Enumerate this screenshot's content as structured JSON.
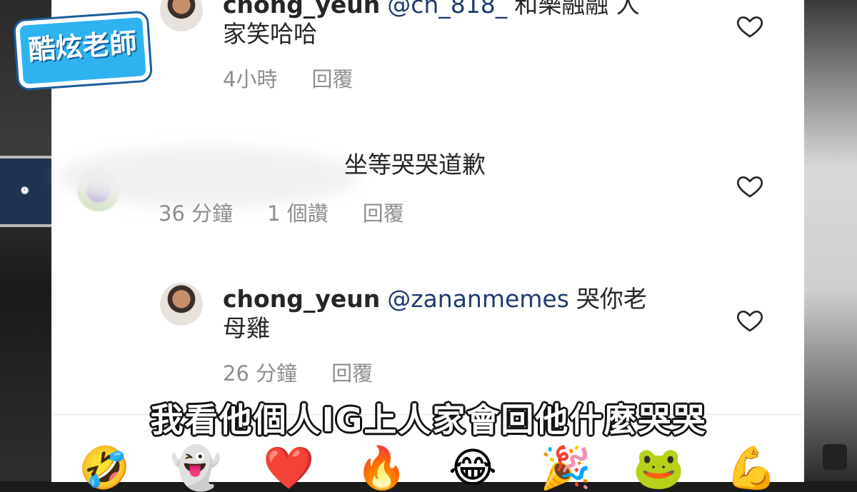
{
  "channel_logo": "酷炫老師",
  "comments": [
    {
      "username": "chong_yeun",
      "mention": "@ch_818_",
      "text_line1": "和樂融融 人",
      "text_line2": "家笑哈哈",
      "time": "4小時",
      "reply": "回覆"
    },
    {
      "username": "",
      "text": "坐等哭哭道歉",
      "time": "36 分鐘",
      "likes": "1 個讚",
      "reply": "回覆"
    },
    {
      "username": "chong_yeun",
      "mention": "@zananmemes",
      "text_line1": "哭你老",
      "text_line2": "母雞",
      "time": "26 分鐘",
      "reply": "回覆"
    }
  ],
  "subtitle": "我看他個人IG上人家會回他什麼哭哭",
  "emoji_bar": [
    "🤣",
    "👻",
    "❤️",
    "🔥",
    "😂",
    "🎉",
    "🐸",
    "💪"
  ],
  "colors": {
    "mention": "#1f3b6e",
    "meta": "#8e8e8e",
    "logo_bg": "#2fb3f0"
  }
}
